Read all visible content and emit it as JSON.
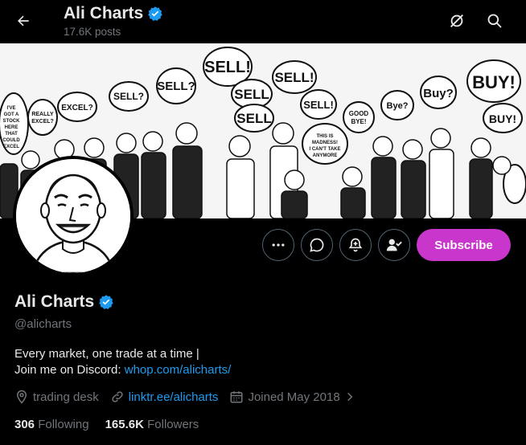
{
  "header": {
    "title": "Ali Charts",
    "posts_count": "17.6K posts"
  },
  "banner": {
    "bubbles": [
      "SELL!",
      "SELL?",
      "SELL!",
      "SELL",
      "SELL",
      "SELL!",
      "Buy?",
      "BUY!",
      "BUY!",
      "Bye?",
      "EXCEL?",
      "SELL?",
      "I'VE GOT A STOCK HERE THAT COULD EXCEL",
      "REALLY EXCEL?",
      "GOOD BYE!",
      "THIS IS MADNESS! I CAN'T TAKE ANYMORE"
    ]
  },
  "actions": {
    "subscribe_label": "Subscribe"
  },
  "profile": {
    "name": "Ali Charts",
    "handle": "@alicharts",
    "bio_line1": "Every market, one trade at a time |",
    "bio_line2_prefix": "Join me on Discord: ",
    "bio_link": "whop.com/alicharts/",
    "location": "trading desk",
    "website": "linktr.ee/alicharts",
    "joined": "Joined May 2018",
    "following_count": "306",
    "following_label": "Following",
    "followers_count": "165.6K",
    "followers_label": "Followers"
  },
  "colors": {
    "accent": "#1d9bf0",
    "subscribe": "#c936cc",
    "verified": "#1d9bf0"
  },
  "icons": [
    "back-arrow-icon",
    "verified-badge-icon",
    "grok-icon",
    "search-icon",
    "more-icon",
    "message-icon",
    "notification-bell-icon",
    "following-check-icon",
    "location-icon",
    "link-icon",
    "calendar-icon",
    "chevron-right-icon"
  ]
}
